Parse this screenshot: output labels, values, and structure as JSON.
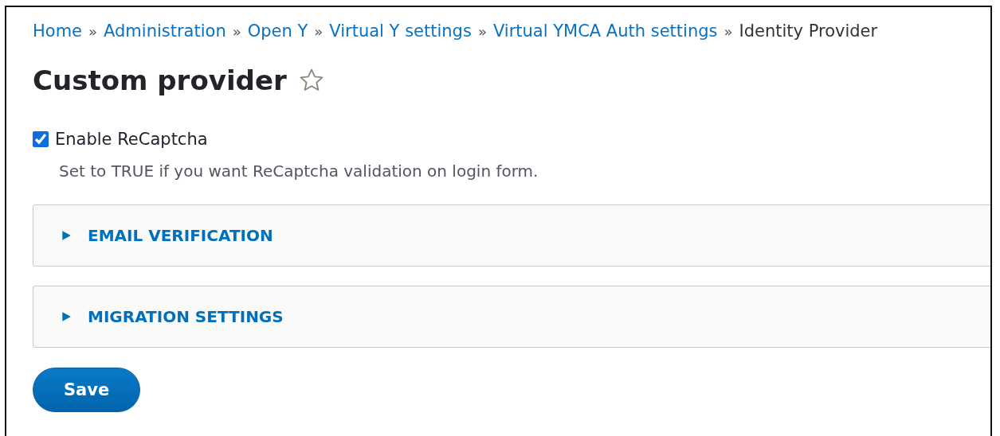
{
  "breadcrumb": [
    {
      "label": "Home",
      "link": true
    },
    {
      "separator": "»",
      "label": "Administration",
      "link": true
    },
    {
      "separator": "»",
      "label": "Open Y",
      "link": true
    },
    {
      "separator": "»",
      "label": "Virtual Y settings",
      "link": true
    },
    {
      "separator": "»",
      "label": "Virtual YMCA Auth settings",
      "link": true
    },
    {
      "separator": "»",
      "label": "Identity Provider",
      "link": false
    }
  ],
  "page": {
    "title": "Custom provider",
    "favorite": false
  },
  "recaptcha": {
    "label": "Enable ReCaptcha",
    "checked": true,
    "description": "Set to TRUE if you want ReCaptcha validation on login form."
  },
  "sections": [
    {
      "label": "EMAIL VERIFICATION",
      "expanded": false
    },
    {
      "label": "MIGRATION SETTINGS",
      "expanded": false
    }
  ],
  "buttons": [
    {
      "label": "Save",
      "kind": "primary"
    }
  ]
}
